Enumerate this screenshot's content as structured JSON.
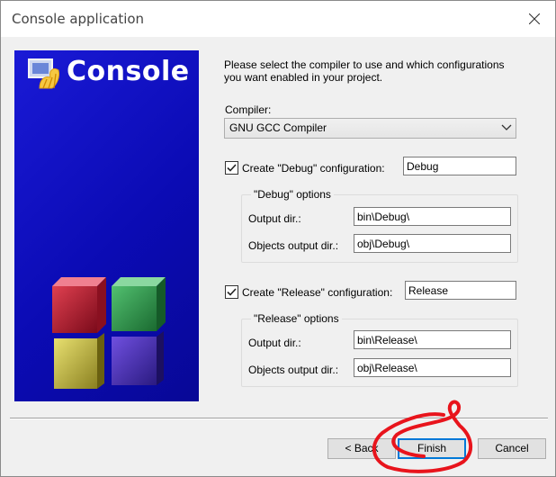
{
  "window": {
    "title": "Console application"
  },
  "panel": {
    "title": "Console"
  },
  "intro": {
    "line1": "Please select the compiler to use and which configurations",
    "line2": "you want enabled in your project."
  },
  "compiler": {
    "label": "Compiler:",
    "selected": "GNU GCC Compiler"
  },
  "debug": {
    "checkbox_label": "Create \"Debug\" configuration:",
    "checked": true,
    "name": "Debug",
    "group_title": "\"Debug\" options",
    "output_label": "Output dir.:",
    "output_value": "bin\\Debug\\",
    "objects_label": "Objects output dir.:",
    "objects_value": "obj\\Debug\\"
  },
  "release": {
    "checkbox_label": "Create \"Release\" configuration:",
    "checked": true,
    "name": "Release",
    "group_title": "\"Release\" options",
    "output_label": "Output dir.:",
    "output_value": "bin\\Release\\",
    "objects_label": "Objects output dir.:",
    "objects_value": "obj\\Release\\"
  },
  "buttons": {
    "back": "< Back",
    "finish": "Finish",
    "cancel": "Cancel"
  },
  "colors": {
    "panel_blue": "#0b0bb4",
    "focus_blue": "#0078d7",
    "annotation_red": "#e8141c"
  }
}
